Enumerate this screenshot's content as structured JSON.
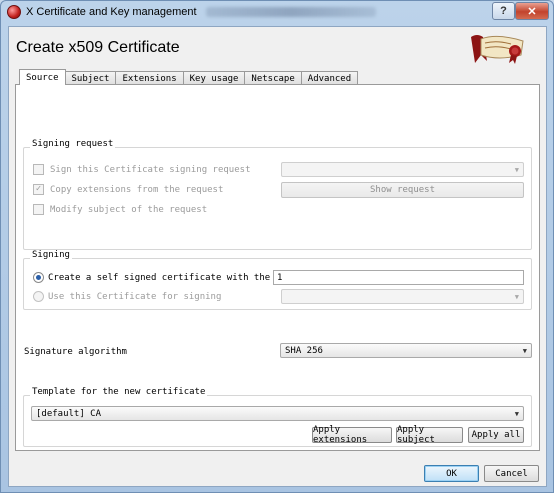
{
  "window": {
    "title": "X Certificate and Key management",
    "help_label": "?",
    "close_label": "✕"
  },
  "dialog": {
    "title": "Create x509 Certificate"
  },
  "tabs": [
    "Source",
    "Subject",
    "Extensions",
    "Key usage",
    "Netscape",
    "Advanced"
  ],
  "signing_request": {
    "group_label": "Signing request",
    "sign_label": "Sign this Certificate signing request",
    "sign_checked": false,
    "copy_label": "Copy extensions from the request",
    "copy_checked": true,
    "modify_label": "Modify subject of the request",
    "modify_checked": false,
    "request_select": "",
    "show_request_label": "Show request"
  },
  "signing": {
    "group_label": "Signing",
    "self_signed_label": "Create a self signed certificate with the serial",
    "serial_value": "1",
    "use_cert_label": "Use this Certificate for signing",
    "cert_select": ""
  },
  "signature": {
    "label": "Signature algorithm",
    "value": "SHA 256"
  },
  "template": {
    "group_label": "Template for the new certificate",
    "selected": "[default] CA",
    "apply_extensions_label": "Apply extensions",
    "apply_subject_label": "Apply subject",
    "apply_all_label": "Apply all"
  },
  "footer": {
    "ok_label": "OK",
    "cancel_label": "Cancel"
  },
  "icons": {
    "app": "xca-app-icon",
    "logo": "xca-logo-seal-icon",
    "dropdown": "chevron-down-icon"
  },
  "colors": {
    "title_bar": "#bcd3ea",
    "close_button": "#c2432c",
    "radio_selected": "#2b5fa8",
    "default_button_border": "#3c7fb1"
  }
}
